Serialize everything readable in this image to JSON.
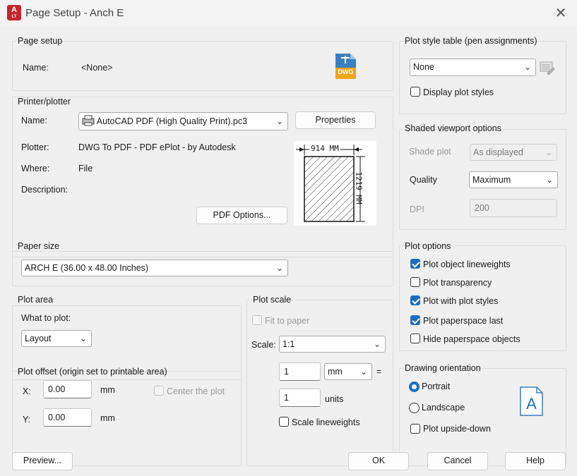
{
  "window": {
    "title": "Page Setup - Anch E",
    "app_icon_letter": "A",
    "app_icon_sub": "LT",
    "close_glyph": "✕"
  },
  "page_setup": {
    "group_title": "Page setup",
    "name_label": "Name:",
    "name_value": "<None>",
    "file_icon_text": "DWG"
  },
  "printer": {
    "group_title": "Printer/plotter",
    "name_label": "Name:",
    "name_value": "AutoCAD PDF (High Quality Print).pc3",
    "properties_button": "Properties",
    "plotter_label": "Plotter:",
    "plotter_value": "DWG To PDF - PDF ePlot - by Autodesk",
    "where_label": "Where:",
    "where_value": "File",
    "description_label": "Description:",
    "pdf_options_button": "PDF Options...",
    "preview_width": "914 MM",
    "preview_height": "1219 MM"
  },
  "paper_size": {
    "group_title": "Paper size",
    "value": "ARCH E (36.00 x 48.00 Inches)"
  },
  "plot_area": {
    "group_title": "Plot area",
    "what_label": "What to plot:",
    "what_value": "Layout"
  },
  "plot_offset": {
    "group_title": "Plot offset (origin set to printable area)",
    "x_label": "X:",
    "x_value": "0.00",
    "x_unit": "mm",
    "y_label": "Y:",
    "y_value": "0.00",
    "y_unit": "mm",
    "center_label": "Center the plot",
    "center_checked": false
  },
  "plot_scale": {
    "group_title": "Plot scale",
    "fit_label": "Fit to paper",
    "scale_label": "Scale:",
    "scale_value": "1:1",
    "value1": "1",
    "unit1": "mm",
    "equals": "=",
    "value2": "1",
    "unit2": "units",
    "lineweights_label": "Scale lineweights"
  },
  "plot_style_table": {
    "group_title": "Plot style table (pen assignments)",
    "value": "None",
    "display_label": "Display plot styles"
  },
  "shaded": {
    "group_title": "Shaded viewport options",
    "shade_label": "Shade plot",
    "shade_value": "As displayed",
    "quality_label": "Quality",
    "quality_value": "Maximum",
    "dpi_label": "DPI",
    "dpi_value": "200"
  },
  "plot_options": {
    "group_title": "Plot options",
    "items": [
      {
        "label": "Plot object lineweights",
        "checked": true
      },
      {
        "label": "Plot transparency",
        "checked": false
      },
      {
        "label": "Plot with plot styles",
        "checked": true
      },
      {
        "label": "Plot paperspace last",
        "checked": true
      },
      {
        "label": "Hide paperspace objects",
        "checked": false
      }
    ]
  },
  "orientation": {
    "group_title": "Drawing orientation",
    "portrait_label": "Portrait",
    "landscape_label": "Landscape",
    "upside_label": "Plot upside-down",
    "selected": "portrait",
    "page_letter": "A"
  },
  "footer": {
    "preview": "Preview...",
    "ok": "OK",
    "cancel": "Cancel",
    "help": "Help"
  },
  "colors": {
    "accent": "#1b6ec2",
    "app_red": "#c4262e",
    "dialog_bg": "#f0f0f0"
  }
}
